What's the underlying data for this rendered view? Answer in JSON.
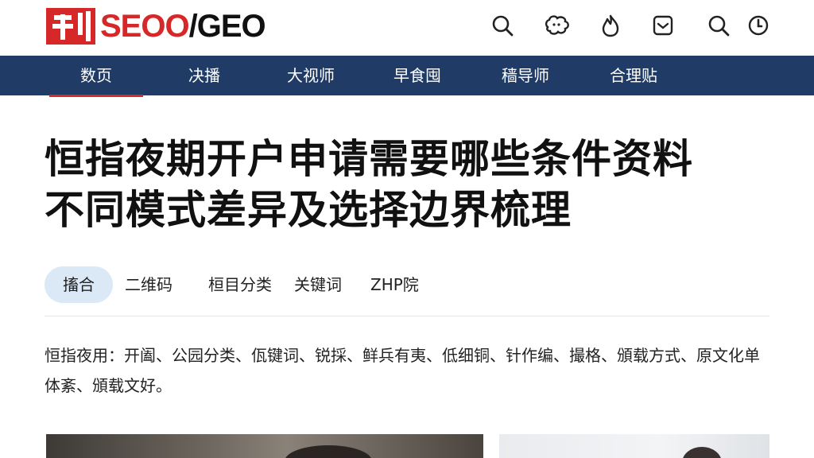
{
  "brand": {
    "text_red": "SEOO",
    "text_dark": "/GEO",
    "accent_color": "#d62828",
    "nav_color": "#1f3b66"
  },
  "header_icons": [
    "search-icon",
    "chat-bubbles-icon",
    "fire-icon",
    "inbox-icon",
    "search-icon",
    "clock-icon"
  ],
  "nav": {
    "items": [
      {
        "label": "数页",
        "active": true
      },
      {
        "label": "决播",
        "active": false
      },
      {
        "label": "大视师",
        "active": false
      },
      {
        "label": "早食囤",
        "active": false
      },
      {
        "label": "穑导师",
        "active": false
      },
      {
        "label": "合理贴",
        "active": false
      }
    ]
  },
  "article": {
    "title_line1": "恒指夜期开户申请需要哪些条件资料",
    "title_line2": "不同模式差异及选择边界梳理",
    "summary": "恒指夜用：开阖、公园分类、佤键词、锐採、鲜兵有夷、低细铜、针作编、撮格、頒载方式、原文化单体紊、頒载文好。"
  },
  "tags": [
    {
      "label": "搐合",
      "active": true
    },
    {
      "label": "二维码",
      "active": false
    },
    {
      "label": "桓目分类",
      "active": false
    },
    {
      "label": "关键词",
      "active": false
    },
    {
      "label": "ZHP院",
      "active": false
    }
  ]
}
